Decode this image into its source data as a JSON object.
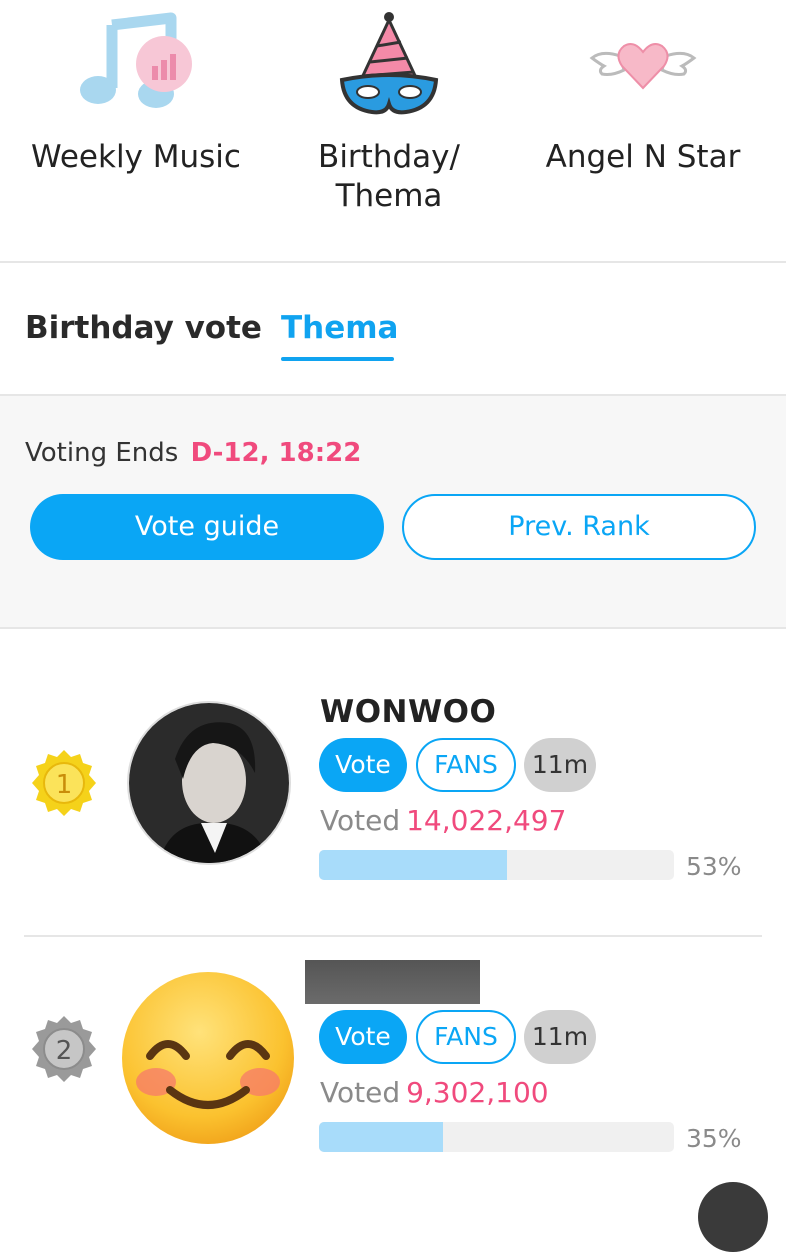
{
  "top_nav": {
    "items": [
      {
        "label": "Weekly Music",
        "icon": "music-notes-chart-icon"
      },
      {
        "label": "Birthday/\nThema",
        "icon": "party-hat-mask-icon"
      },
      {
        "label": "Angel N Star",
        "icon": "winged-heart-icon"
      }
    ]
  },
  "subtabs": {
    "birthday": "Birthday vote",
    "thema": "Thema",
    "active": "Thema"
  },
  "voting": {
    "ends_label": "Voting Ends",
    "deadline": "D-12, 18:22",
    "guide_button": "Vote guide",
    "prev_rank_button": "Prev. Rank"
  },
  "ranking": [
    {
      "rank": "1",
      "name": "WONWOO",
      "vote_label": "Vote",
      "fans_label": "FANS",
      "time": "11m",
      "voted_label": "Voted",
      "votes": "14,022,497",
      "percent_text": "53%",
      "percent": 53
    },
    {
      "rank": "2",
      "name_redacted": true,
      "vote_label": "Vote",
      "fans_label": "FANS",
      "time": "11m",
      "voted_label": "Voted",
      "votes": "9,302,100",
      "percent_text": "35%",
      "percent": 35
    }
  ],
  "colors": {
    "accent_blue": "#0aa6f5",
    "accent_pink": "#f04a7d",
    "bar_fill": "#a8dcfa",
    "bar_track": "#f0f0f0"
  }
}
